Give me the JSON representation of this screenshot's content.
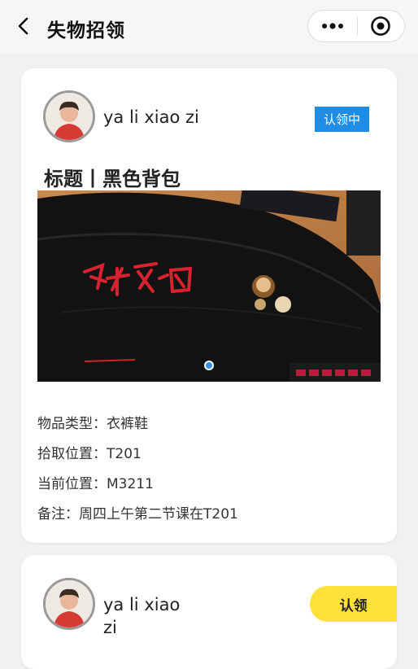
{
  "navbar": {
    "title": "失物招领",
    "back_icon": "chevron-left-icon",
    "more_icon": "more-dots-icon",
    "close_icon": "target-circle-icon"
  },
  "posts": [
    {
      "username": "ya li xiao zi",
      "status": "认领中",
      "status_color": "#1f8ce6",
      "title": "标题丨黑色背包",
      "details": [
        {
          "label": "物品类型：",
          "value": "衣裤鞋"
        },
        {
          "label": "拾取位置：",
          "value": "T201"
        },
        {
          "label": "当前位置：",
          "value": "M3211"
        },
        {
          "label": "备注：",
          "value": "周四上午第二节课在T201"
        }
      ]
    },
    {
      "username_line1": "ya li xiao",
      "username_line2": "zi",
      "action_label": "认领",
      "action_color": "#ffe13a"
    }
  ]
}
